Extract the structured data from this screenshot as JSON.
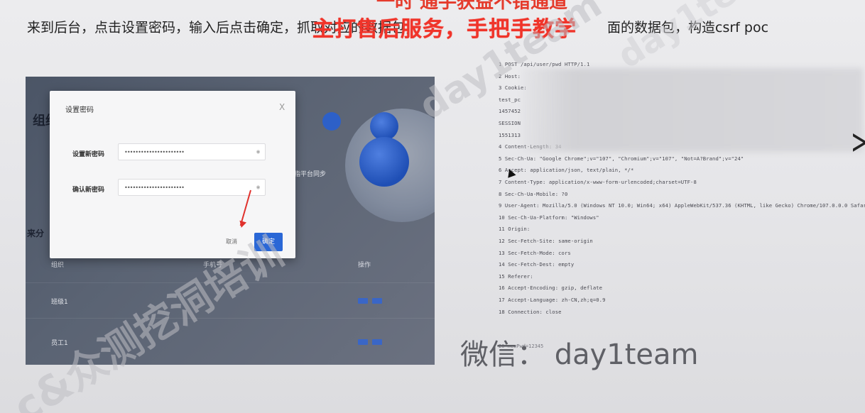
{
  "top_banner_partial": "一时 通手获益不错通道",
  "caption": {
    "part1": "来到后台，点击设置密码，输入后点击确定，抓取对应的数据包，",
    "part2": "面的数据包，构造csrf poc"
  },
  "promo": "主打售后服务，手把手教学",
  "watermarks": [
    "day1team",
    "c&众测挖洞培训",
    "day1team"
  ],
  "screenshot": {
    "bg_texts": [
      "组织",
      "来分",
      "指平台同步"
    ],
    "dialog": {
      "title": "设置密码",
      "close": "X",
      "new_password_label": "设置新密码",
      "new_password_value": "••••••••••••••••••••••",
      "confirm_password_label": "确认新密码",
      "confirm_password_value": "••••••••••••••••••••••",
      "eye_icon": "eye-icon",
      "cancel_label": "取消",
      "ok_label": "确定"
    },
    "table": {
      "headers": [
        "组织",
        "手机号",
        "操作"
      ],
      "rows": [
        [
          "班级1",
          "",
          ""
        ],
        [
          "员工1",
          "",
          ""
        ]
      ]
    }
  },
  "request_lines": [
    "1 POST /api/user/pwd HTTP/1.1",
    "2 Host:",
    "3 Cookie:",
    "  test_pc",
    "  1457452",
    "  SESSION",
    "  1551313",
    "4 Content-Length: 34",
    "5 Sec-Ch-Ua: \"Google Chrome\";v=\"107\", \"Chromium\";v=\"107\", \"Not=A?Brand\";v=\"24\"",
    "6 Accept: application/json, text/plain, */*",
    "7 Content-Type: application/x-www-form-urlencoded;charset=UTF-8",
    "8 Sec-Ch-Ua-Mobile: ?0",
    "9 User-Agent: Mozilla/5.0 (Windows NT 10.0; Win64; x64) AppleWebKit/537.36 (KHTML, like Gecko) Chrome/107.0.0.0 Safari/",
    "10 Sec-Ch-Ua-Platform: \"Windows\"",
    "11 Origin:",
    "12 Sec-Fetch-Site: same-origin",
    "13 Sec-Fetch-Mode: cors",
    "14 Sec-Fetch-Dest: empty",
    "15 Referer:",
    "16 Accept-Encoding: gzip, deflate",
    "17 Accept-Language: zh-CN,zh;q=0.9",
    "18 Connection: close"
  ],
  "request_footer": "20 newPwd=12345",
  "wechat": "微信： day1team",
  "next_icon": "chevron-right-icon",
  "colors": {
    "promo": "#f0342a",
    "primary_button": "#2a67d6",
    "arrow": "#e0312c"
  }
}
